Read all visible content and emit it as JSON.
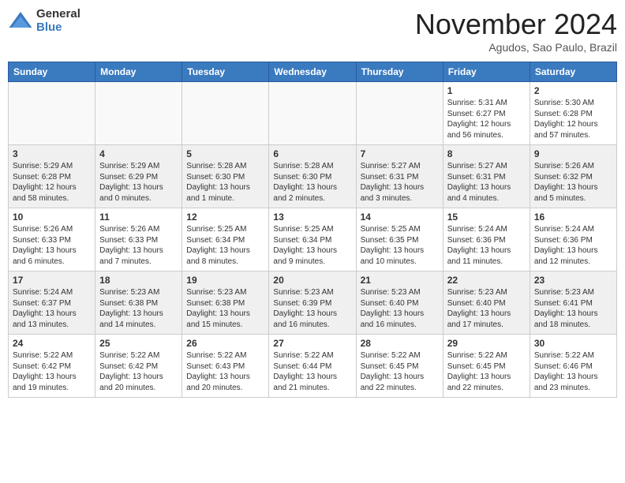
{
  "logo": {
    "general": "General",
    "blue": "Blue"
  },
  "title": "November 2024",
  "location": "Agudos, Sao Paulo, Brazil",
  "headers": [
    "Sunday",
    "Monday",
    "Tuesday",
    "Wednesday",
    "Thursday",
    "Friday",
    "Saturday"
  ],
  "weeks": [
    [
      {
        "day": "",
        "info": ""
      },
      {
        "day": "",
        "info": ""
      },
      {
        "day": "",
        "info": ""
      },
      {
        "day": "",
        "info": ""
      },
      {
        "day": "",
        "info": ""
      },
      {
        "day": "1",
        "info": "Sunrise: 5:31 AM\nSunset: 6:27 PM\nDaylight: 12 hours\nand 56 minutes."
      },
      {
        "day": "2",
        "info": "Sunrise: 5:30 AM\nSunset: 6:28 PM\nDaylight: 12 hours\nand 57 minutes."
      }
    ],
    [
      {
        "day": "3",
        "info": "Sunrise: 5:29 AM\nSunset: 6:28 PM\nDaylight: 12 hours\nand 58 minutes."
      },
      {
        "day": "4",
        "info": "Sunrise: 5:29 AM\nSunset: 6:29 PM\nDaylight: 13 hours\nand 0 minutes."
      },
      {
        "day": "5",
        "info": "Sunrise: 5:28 AM\nSunset: 6:30 PM\nDaylight: 13 hours\nand 1 minute."
      },
      {
        "day": "6",
        "info": "Sunrise: 5:28 AM\nSunset: 6:30 PM\nDaylight: 13 hours\nand 2 minutes."
      },
      {
        "day": "7",
        "info": "Sunrise: 5:27 AM\nSunset: 6:31 PM\nDaylight: 13 hours\nand 3 minutes."
      },
      {
        "day": "8",
        "info": "Sunrise: 5:27 AM\nSunset: 6:31 PM\nDaylight: 13 hours\nand 4 minutes."
      },
      {
        "day": "9",
        "info": "Sunrise: 5:26 AM\nSunset: 6:32 PM\nDaylight: 13 hours\nand 5 minutes."
      }
    ],
    [
      {
        "day": "10",
        "info": "Sunrise: 5:26 AM\nSunset: 6:33 PM\nDaylight: 13 hours\nand 6 minutes."
      },
      {
        "day": "11",
        "info": "Sunrise: 5:26 AM\nSunset: 6:33 PM\nDaylight: 13 hours\nand 7 minutes."
      },
      {
        "day": "12",
        "info": "Sunrise: 5:25 AM\nSunset: 6:34 PM\nDaylight: 13 hours\nand 8 minutes."
      },
      {
        "day": "13",
        "info": "Sunrise: 5:25 AM\nSunset: 6:34 PM\nDaylight: 13 hours\nand 9 minutes."
      },
      {
        "day": "14",
        "info": "Sunrise: 5:25 AM\nSunset: 6:35 PM\nDaylight: 13 hours\nand 10 minutes."
      },
      {
        "day": "15",
        "info": "Sunrise: 5:24 AM\nSunset: 6:36 PM\nDaylight: 13 hours\nand 11 minutes."
      },
      {
        "day": "16",
        "info": "Sunrise: 5:24 AM\nSunset: 6:36 PM\nDaylight: 13 hours\nand 12 minutes."
      }
    ],
    [
      {
        "day": "17",
        "info": "Sunrise: 5:24 AM\nSunset: 6:37 PM\nDaylight: 13 hours\nand 13 minutes."
      },
      {
        "day": "18",
        "info": "Sunrise: 5:23 AM\nSunset: 6:38 PM\nDaylight: 13 hours\nand 14 minutes."
      },
      {
        "day": "19",
        "info": "Sunrise: 5:23 AM\nSunset: 6:38 PM\nDaylight: 13 hours\nand 15 minutes."
      },
      {
        "day": "20",
        "info": "Sunrise: 5:23 AM\nSunset: 6:39 PM\nDaylight: 13 hours\nand 16 minutes."
      },
      {
        "day": "21",
        "info": "Sunrise: 5:23 AM\nSunset: 6:40 PM\nDaylight: 13 hours\nand 16 minutes."
      },
      {
        "day": "22",
        "info": "Sunrise: 5:23 AM\nSunset: 6:40 PM\nDaylight: 13 hours\nand 17 minutes."
      },
      {
        "day": "23",
        "info": "Sunrise: 5:23 AM\nSunset: 6:41 PM\nDaylight: 13 hours\nand 18 minutes."
      }
    ],
    [
      {
        "day": "24",
        "info": "Sunrise: 5:22 AM\nSunset: 6:42 PM\nDaylight: 13 hours\nand 19 minutes."
      },
      {
        "day": "25",
        "info": "Sunrise: 5:22 AM\nSunset: 6:42 PM\nDaylight: 13 hours\nand 20 minutes."
      },
      {
        "day": "26",
        "info": "Sunrise: 5:22 AM\nSunset: 6:43 PM\nDaylight: 13 hours\nand 20 minutes."
      },
      {
        "day": "27",
        "info": "Sunrise: 5:22 AM\nSunset: 6:44 PM\nDaylight: 13 hours\nand 21 minutes."
      },
      {
        "day": "28",
        "info": "Sunrise: 5:22 AM\nSunset: 6:45 PM\nDaylight: 13 hours\nand 22 minutes."
      },
      {
        "day": "29",
        "info": "Sunrise: 5:22 AM\nSunset: 6:45 PM\nDaylight: 13 hours\nand 22 minutes."
      },
      {
        "day": "30",
        "info": "Sunrise: 5:22 AM\nSunset: 6:46 PM\nDaylight: 13 hours\nand 23 minutes."
      }
    ]
  ]
}
